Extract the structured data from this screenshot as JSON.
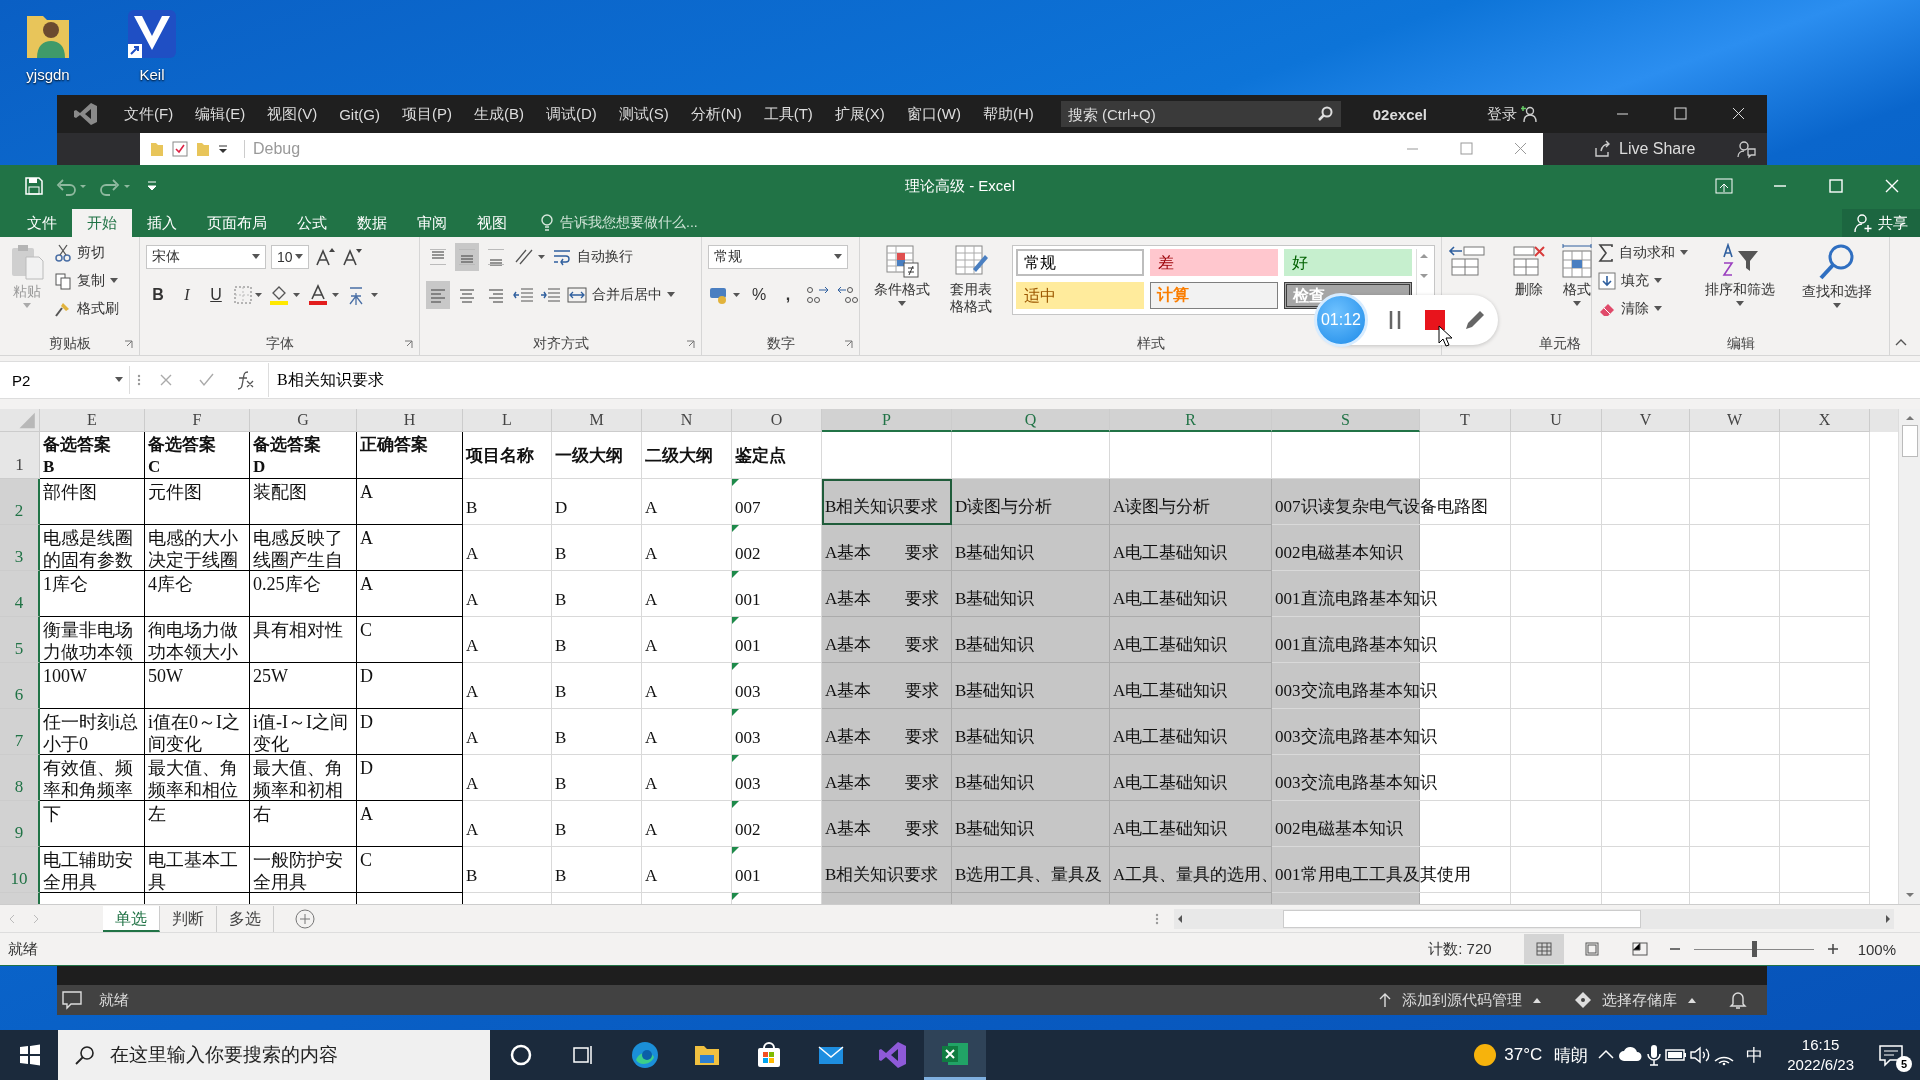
{
  "desktop_icons": [
    {
      "label": "yjsgdn",
      "kind": "user"
    },
    {
      "label": "Keil",
      "kind": "keil"
    }
  ],
  "vs": {
    "menu": [
      "文件(F)",
      "编辑(E)",
      "视图(V)",
      "Git(G)",
      "项目(P)",
      "生成(B)",
      "调试(D)",
      "测试(S)",
      "分析(N)",
      "工具(T)",
      "扩展(X)",
      "窗口(W)",
      "帮助(H)"
    ],
    "search": {
      "placeholder": "搜索 (Ctrl+Q)"
    },
    "solution": "02excel",
    "login": "登录",
    "config": "Debug",
    "live_share": "Live Share",
    "status": "就绪",
    "status_items": [
      "添加到源代码管理",
      "选择存储库"
    ]
  },
  "excel": {
    "title": "理论高级 - Excel",
    "tabs": [
      {
        "label": "文件",
        "selected": false
      },
      {
        "label": "开始",
        "selected": true
      },
      {
        "label": "插入",
        "selected": false
      },
      {
        "label": "页面布局",
        "selected": false
      },
      {
        "label": "公式",
        "selected": false
      },
      {
        "label": "数据",
        "selected": false
      },
      {
        "label": "审阅",
        "selected": false
      },
      {
        "label": "视图",
        "selected": false
      }
    ],
    "tell_me": "告诉我您想要做什么...",
    "share": "共享",
    "ribbon": {
      "clipboard": {
        "label": "剪贴板",
        "paste": "粘贴",
        "cut": "剪切",
        "copy": "复制",
        "painter": "格式刷"
      },
      "font": {
        "label": "字体",
        "name": "宋体",
        "size": "10",
        "bold": "B",
        "italic": "I",
        "underline": "U"
      },
      "alignment": {
        "label": "对齐方式",
        "wrap": "自动换行",
        "merge": "合并后居中",
        "valign": [
          {
            "selected": false
          },
          {
            "selected": true
          },
          {
            "selected": false
          }
        ],
        "halign": [
          {
            "selected": true
          },
          {
            "selected": false
          },
          {
            "selected": false
          }
        ]
      },
      "number": {
        "label": "数字",
        "format": "常规",
        "percent": "%",
        "comma": ","
      },
      "styles": {
        "label": "样式",
        "conditional": "条件格式",
        "table": "套用表格格式",
        "gallery": [
          {
            "label": "常规",
            "kind": "normal"
          },
          {
            "label": "差",
            "kind": "bad"
          },
          {
            "label": "好",
            "kind": "good"
          },
          {
            "label": "适中",
            "kind": "neutral"
          },
          {
            "label": "计算",
            "kind": "calc"
          },
          {
            "label": "检查",
            "kind": "check"
          }
        ]
      },
      "cells": {
        "label": "单元格",
        "delete": "删除",
        "format": "格式"
      },
      "editing": {
        "label": "编辑",
        "autosum": "自动求和",
        "fill": "填充",
        "clear": "清除",
        "sort": "排序和筛选",
        "find": "查找和选择"
      }
    },
    "recorder": {
      "time": "01:12"
    },
    "formula_bar": {
      "name_box": "P2",
      "formula": "B相关知识要求"
    },
    "sheet": {
      "columns": [
        {
          "label": "E",
          "selected": false,
          "active": false,
          "bordered": true
        },
        {
          "label": "F",
          "selected": false,
          "active": false,
          "bordered": true
        },
        {
          "label": "G",
          "selected": false,
          "active": false,
          "bordered": true
        },
        {
          "label": "H",
          "selected": false,
          "active": false,
          "bordered": true
        },
        {
          "label": "L",
          "selected": false,
          "active": false,
          "bordered": false
        },
        {
          "label": "M",
          "selected": false,
          "active": false,
          "bordered": false
        },
        {
          "label": "N",
          "selected": false,
          "active": false,
          "bordered": false
        },
        {
          "label": "O",
          "selected": false,
          "active": false,
          "bordered": false
        },
        {
          "label": "P",
          "selected": true,
          "active": true,
          "bordered": false
        },
        {
          "label": "Q",
          "selected": true,
          "active": false,
          "bordered": false
        },
        {
          "label": "R",
          "selected": true,
          "active": false,
          "bordered": false
        },
        {
          "label": "S",
          "selected": true,
          "active": false,
          "bordered": false
        },
        {
          "label": "T",
          "selected": false,
          "active": false,
          "bordered": false
        },
        {
          "label": "U",
          "selected": false,
          "active": false,
          "bordered": false
        },
        {
          "label": "V",
          "selected": false,
          "active": false,
          "bordered": false
        },
        {
          "label": "W",
          "selected": false,
          "active": false,
          "bordered": false
        },
        {
          "label": "X",
          "selected": false,
          "active": false,
          "bordered": false
        }
      ],
      "rows": [
        {
          "label": "1",
          "kind": "header",
          "selected": false,
          "active": false,
          "cells": [
            "备选答案\nB",
            "备选答案\nC",
            "备选答案\nD",
            "正确答案",
            "项目名称",
            "一级大纲",
            "二级大纲",
            "鉴定点"
          ]
        },
        {
          "label": "2",
          "kind": "data",
          "selected": true,
          "active": true,
          "cells": [
            "部件图",
            "元件图",
            "装配图",
            "A",
            "B",
            "D",
            "A",
            "007",
            "B相关知识要求",
            "D读图与分析",
            "A读图与分析",
            "007识读复杂电气设备电路图"
          ]
        },
        {
          "label": "3",
          "kind": "data",
          "selected": true,
          "active": false,
          "cells": [
            "电感是线圈的固有参数",
            "电感的大小决定于线圈",
            "电感反映了线圈产生自",
            "A",
            "A",
            "B",
            "A",
            "002",
            "A基本　　要求",
            "B基础知识",
            "A电工基础知识",
            "002电磁基本知识"
          ]
        },
        {
          "label": "4",
          "kind": "data",
          "selected": true,
          "active": false,
          "cells": [
            "1库仑",
            "4库仑",
            "0.25库仑",
            "A",
            "A",
            "B",
            "A",
            "001",
            "A基本　　要求",
            "B基础知识",
            "A电工基础知识",
            "001直流电路基本知识"
          ]
        },
        {
          "label": "5",
          "kind": "data",
          "selected": true,
          "active": false,
          "cells": [
            "衡量非电场力做功本领",
            "徇电场力做功本领大小",
            "具有相对性",
            "C",
            "A",
            "B",
            "A",
            "001",
            "A基本　　要求",
            "B基础知识",
            "A电工基础知识",
            "001直流电路基本知识"
          ]
        },
        {
          "label": "6",
          "kind": "data",
          "selected": true,
          "active": false,
          "cells": [
            "100W",
            "50W",
            "25W",
            "D",
            "A",
            "B",
            "A",
            "003",
            "A基本　　要求",
            "B基础知识",
            "A电工基础知识",
            "003交流电路基本知识"
          ]
        },
        {
          "label": "7",
          "kind": "data",
          "selected": true,
          "active": false,
          "cells": [
            "任一时刻i总小于0",
            "i值在0～I之间变化",
            "i值-I～I之间变化",
            "D",
            "A",
            "B",
            "A",
            "003",
            "A基本　　要求",
            "B基础知识",
            "A电工基础知识",
            "003交流电路基本知识"
          ]
        },
        {
          "label": "8",
          "kind": "data",
          "selected": true,
          "active": false,
          "cells": [
            "有效值、频率和角频率",
            "最大值、角频率和相位",
            "最大值、角频率和初相",
            "D",
            "A",
            "B",
            "A",
            "003",
            "A基本　　要求",
            "B基础知识",
            "A电工基础知识",
            "003交流电路基本知识"
          ]
        },
        {
          "label": "9",
          "kind": "data",
          "selected": true,
          "active": false,
          "cells": [
            "下",
            "左",
            "右",
            "A",
            "A",
            "B",
            "A",
            "002",
            "A基本　　要求",
            "B基础知识",
            "A电工基础知识",
            "002电磁基本知识"
          ]
        },
        {
          "label": "10",
          "kind": "data",
          "selected": true,
          "active": false,
          "cells": [
            "电工辅助安全用具",
            "电工基本工具",
            "一般防护安全用具",
            "C",
            "B",
            "B",
            "A",
            "001",
            "B相关知识要求",
            "B选用工具、量具及",
            "A工具、量具的选用、",
            "001常用电工工具及其使用"
          ]
        },
        {
          "kind": "data",
          "selected": true,
          "active": false
        }
      ]
    },
    "sheet_tabs": [
      {
        "label": "单选",
        "selected": true
      },
      {
        "label": "判断",
        "selected": false
      },
      {
        "label": "多选",
        "selected": false
      }
    ],
    "status": {
      "ready": "就绪",
      "count": "计数: 720",
      "views": [
        {
          "kind": "normal",
          "selected": true
        },
        {
          "kind": "layout",
          "selected": false
        },
        {
          "kind": "break",
          "selected": false
        }
      ],
      "zoom": {
        "level": 0.5,
        "reading": "100%"
      }
    }
  },
  "taskbar": {
    "search": {
      "placeholder": "在这里输入你要搜索的内容"
    },
    "apps": [
      {
        "kind": "cortana",
        "active": false
      },
      {
        "kind": "taskview",
        "active": false
      },
      {
        "kind": "edge",
        "active": false
      },
      {
        "kind": "explorer",
        "active": false
      },
      {
        "kind": "store",
        "active": false
      },
      {
        "kind": "mail",
        "active": false
      },
      {
        "kind": "vs",
        "active": false
      },
      {
        "kind": "excel",
        "active": true
      }
    ],
    "weather": "37°C",
    "weather_text": "晴朗",
    "ime": "中",
    "time": "16:15",
    "date": "2022/6/23",
    "notifications": "5"
  }
}
